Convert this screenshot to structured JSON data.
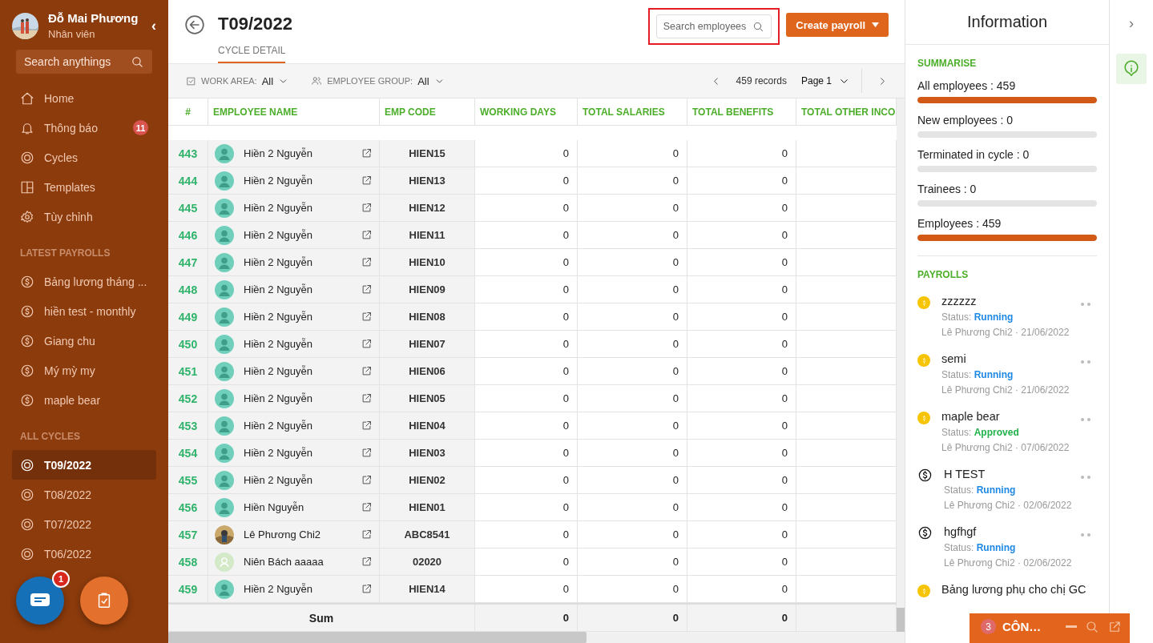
{
  "sidebar": {
    "user": {
      "name": "Đỗ Mai Phương",
      "role": "Nhân viên"
    },
    "collapse": "‹",
    "search": {
      "placeholder": "Search anythings"
    },
    "nav": [
      {
        "label": "Home",
        "kind": "home"
      },
      {
        "label": "Thông báo",
        "kind": "bell",
        "badge": "11"
      },
      {
        "label": "Cycles",
        "kind": "target"
      },
      {
        "label": "Templates",
        "kind": "layout"
      },
      {
        "label": "Tùy chỉnh",
        "kind": "gear"
      }
    ],
    "latest_title": "LATEST PAYROLLS",
    "latest": [
      "Bảng lương tháng ...",
      "hiền test - monthly",
      "Giang chu",
      "Mý mỳ my",
      "maple bear"
    ],
    "cycles_title": "ALL CYCLES",
    "cycles": [
      {
        "label": "T09/2022",
        "selected": true
      },
      {
        "label": "T08/2022",
        "selected": false
      },
      {
        "label": "T07/2022",
        "selected": false
      },
      {
        "label": "T06/2022",
        "selected": false
      }
    ],
    "chat_badge": "1"
  },
  "header": {
    "title": "T09/2022",
    "tabs": [
      {
        "label": "CYCLE DETAIL",
        "selected": true
      }
    ],
    "search": {
      "placeholder": "Search employees",
      "highlighted": true
    },
    "create_button": "Create payroll"
  },
  "filters": {
    "work_area": {
      "label": "WORK AREA:",
      "value": "All"
    },
    "employee_group": {
      "label": "EMPLOYEE GROUP:",
      "value": "All"
    },
    "records": "459 records",
    "page": "Page 1"
  },
  "table": {
    "columns": [
      "#",
      "EMPLOYEE NAME",
      "EMP CODE",
      "WORKING DAYS",
      "TOTAL SALARIES",
      "TOTAL BENEFITS",
      "TOTAL OTHER INCO"
    ],
    "rows": [
      {
        "no": "443",
        "name": "Hiền 2 Nguyễn",
        "kind": "generic",
        "code": "HIEN15",
        "values": [
          "0",
          "0",
          "0"
        ]
      },
      {
        "no": "444",
        "name": "Hiền 2 Nguyễn",
        "kind": "generic",
        "code": "HIEN13",
        "values": [
          "0",
          "0",
          "0"
        ]
      },
      {
        "no": "445",
        "name": "Hiền 2 Nguyễn",
        "kind": "generic",
        "code": "HIEN12",
        "values": [
          "0",
          "0",
          "0"
        ]
      },
      {
        "no": "446",
        "name": "Hiền 2 Nguyễn",
        "kind": "generic",
        "code": "HIEN11",
        "values": [
          "0",
          "0",
          "0"
        ]
      },
      {
        "no": "447",
        "name": "Hiền 2 Nguyễn",
        "kind": "generic",
        "code": "HIEN10",
        "values": [
          "0",
          "0",
          "0"
        ]
      },
      {
        "no": "448",
        "name": "Hiền 2 Nguyễn",
        "kind": "generic",
        "code": "HIEN09",
        "values": [
          "0",
          "0",
          "0"
        ]
      },
      {
        "no": "449",
        "name": "Hiền 2 Nguyễn",
        "kind": "generic",
        "code": "HIEN08",
        "values": [
          "0",
          "0",
          "0"
        ]
      },
      {
        "no": "450",
        "name": "Hiền 2 Nguyễn",
        "kind": "generic",
        "code": "HIEN07",
        "values": [
          "0",
          "0",
          "0"
        ]
      },
      {
        "no": "451",
        "name": "Hiền 2 Nguyễn",
        "kind": "generic",
        "code": "HIEN06",
        "values": [
          "0",
          "0",
          "0"
        ]
      },
      {
        "no": "452",
        "name": "Hiền 2 Nguyễn",
        "kind": "generic",
        "code": "HIEN05",
        "values": [
          "0",
          "0",
          "0"
        ]
      },
      {
        "no": "453",
        "name": "Hiền 2 Nguyễn",
        "kind": "generic",
        "code": "HIEN04",
        "values": [
          "0",
          "0",
          "0"
        ]
      },
      {
        "no": "454",
        "name": "Hiền 2 Nguyễn",
        "kind": "generic",
        "code": "HIEN03",
        "values": [
          "0",
          "0",
          "0"
        ]
      },
      {
        "no": "455",
        "name": "Hiền 2 Nguyễn",
        "kind": "generic",
        "code": "HIEN02",
        "values": [
          "0",
          "0",
          "0"
        ]
      },
      {
        "no": "456",
        "name": "Hiền Nguyễn",
        "kind": "generic",
        "code": "HIEN01",
        "values": [
          "0",
          "0",
          "0"
        ]
      },
      {
        "no": "457",
        "name": "Lê Phương Chi2",
        "code": "ABC8541",
        "values": [
          "0",
          "0",
          "0"
        ]
      },
      {
        "no": "458",
        "name": "Niên Bách aaaaa",
        "kind": "placeholder",
        "code": "02020",
        "values": [
          "0",
          "0",
          "0"
        ]
      },
      {
        "no": "459",
        "name": "Hiền 2 Nguyễn",
        "kind": "generic",
        "code": "HIEN14",
        "values": [
          "0",
          "0",
          "0"
        ]
      }
    ],
    "sum": {
      "label": "Sum",
      "values": [
        "0",
        "0",
        "0"
      ]
    }
  },
  "info": {
    "title": "Information",
    "summarise_title": "SUMMARISE",
    "stats": [
      {
        "label": "All employees : 459",
        "level": 1
      },
      {
        "label": "New employees : 0",
        "level": 0
      },
      {
        "label": "Terminated in cycle : 0",
        "level": 0
      },
      {
        "label": "Trainees : 0",
        "level": 0
      },
      {
        "label": "Employees : 459",
        "level": 1
      }
    ],
    "payrolls_title": "PAYROLLS",
    "payrolls": [
      {
        "name": "zzzzzz",
        "kind": "coin",
        "status_label": "Status:",
        "status": {
          "text": "Running",
          "color": "#1e88e5"
        },
        "meta": "Lê Phương Chi2 · 21/06/2022"
      },
      {
        "name": "semi",
        "kind": "coin",
        "status_label": "Status:",
        "status": {
          "text": "Running",
          "color": "#1e88e5"
        },
        "meta": "Lê Phương Chi2 · 21/06/2022"
      },
      {
        "name": "maple bear",
        "kind": "coin",
        "status_label": "Status:",
        "status": {
          "text": "Approved",
          "color": "#21b24b"
        },
        "meta": "Lê Phương Chi2 · 07/06/2022"
      },
      {
        "name": "H TEST",
        "kind": "outline",
        "status_label": "Status:",
        "status": {
          "text": "Running",
          "color": "#1e88e5"
        },
        "meta": "Lê Phương Chi2 · 02/06/2022"
      },
      {
        "name": "hgfhgf",
        "kind": "outline",
        "status_label": "Status:",
        "status": {
          "text": "Running",
          "color": "#1e88e5"
        },
        "meta": "Lê Phương Chi2 · 02/06/2022"
      },
      {
        "name": "Bảng lương phụ cho chị GC",
        "kind": "coin"
      }
    ],
    "rail_toggle": "›"
  },
  "chat_bar": {
    "count": "3",
    "title": "CÔN…"
  }
}
